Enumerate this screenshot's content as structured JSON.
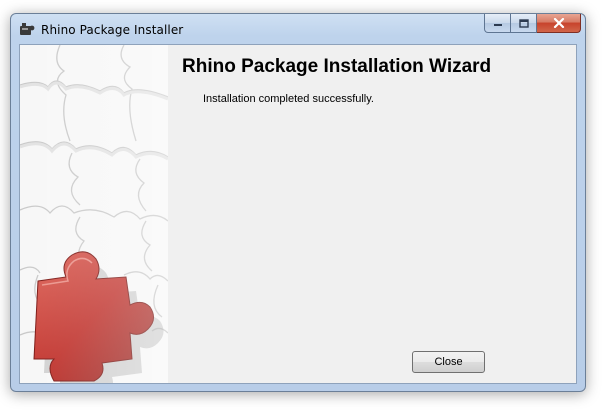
{
  "window": {
    "title": "Rhino Package Installer"
  },
  "wizard": {
    "heading": "Rhino Package Installation Wizard",
    "message": "Installation completed successfully.",
    "close_label": "Close"
  },
  "icons": {
    "app": "puzzle-installer-icon",
    "side_image": "puzzle-pieces-image"
  },
  "colors": {
    "accent_red": "#c0312b",
    "window_frame": "#bed3ec",
    "close_button_red": "#c7432c",
    "client_background": "#f0f0f0"
  }
}
